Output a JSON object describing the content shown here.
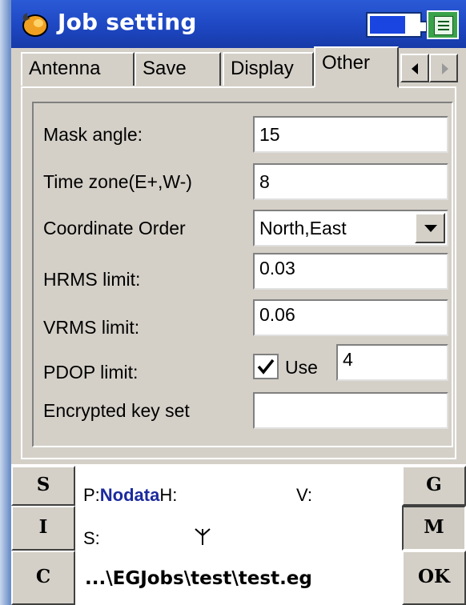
{
  "window": {
    "title": "Job setting"
  },
  "tabs": [
    {
      "label": "Antenna",
      "active": false
    },
    {
      "label": "Save",
      "active": false
    },
    {
      "label": "Display",
      "active": false
    },
    {
      "label": "Other",
      "active": true
    }
  ],
  "form": {
    "mask_angle": {
      "label": "Mask angle:",
      "value": "15"
    },
    "time_zone": {
      "label": "Time zone(E+,W-)",
      "value": "8"
    },
    "coordinate_order": {
      "label": "Coordinate Order",
      "value": "North,East"
    },
    "hrms_limit": {
      "label": "HRMS limit:",
      "value": "0.03"
    },
    "vrms_limit": {
      "label": "VRMS limit:",
      "value": "0.06"
    },
    "pdop_limit": {
      "label": "PDOP limit:",
      "use_label": "Use",
      "use_checked": true,
      "value": "4"
    },
    "encrypted_key": {
      "label": "Encrypted key set",
      "value": ""
    }
  },
  "status": {
    "p_label": "P:",
    "p_value": "Nodata",
    "h_label": "H:",
    "v_label": "V:",
    "s_label": "S:",
    "path": "...\\EGJobs\\test\\test.eg"
  },
  "side_buttons": {
    "left": [
      "S",
      "I",
      "C"
    ],
    "right": [
      "G",
      "M",
      "OK"
    ]
  },
  "colors": {
    "title_bar": "#1e47c2",
    "window_bg": "#d4d0c8",
    "status_value": "#1b2a9e",
    "desktop": "#6f91c9"
  }
}
